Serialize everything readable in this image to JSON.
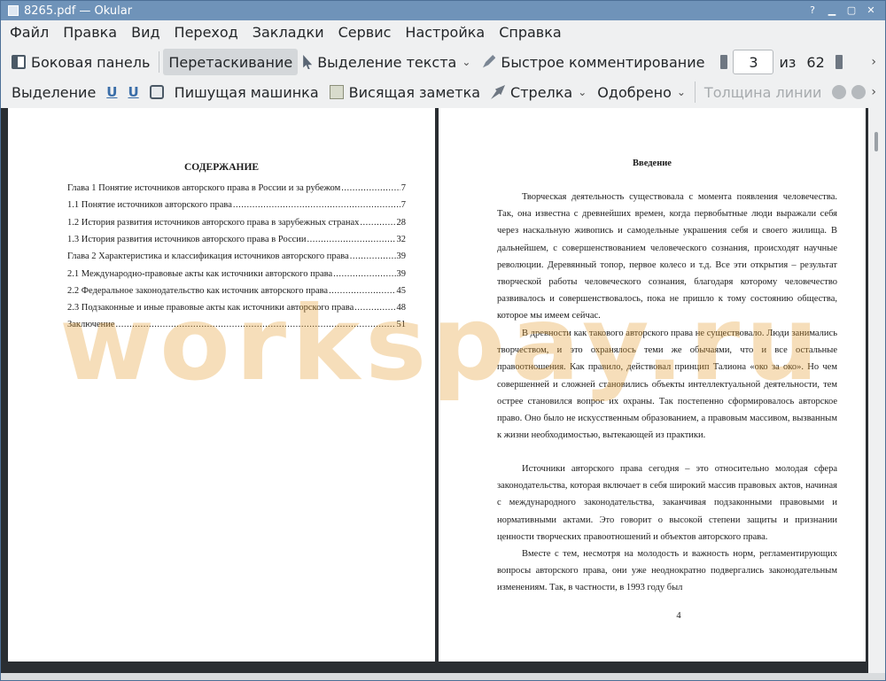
{
  "window": {
    "title": "8265.pdf  — Okular"
  },
  "menu": [
    "Файл",
    "Правка",
    "Вид",
    "Переход",
    "Закладки",
    "Сервис",
    "Настройка",
    "Справка"
  ],
  "toolbar1": {
    "sidebar": "Боковая панель",
    "drag": "Перетаскивание",
    "text_select": "Выделение текста",
    "quick_comment": "Быстрое комментирование",
    "page_current": "3",
    "page_of": "из",
    "page_total": "62"
  },
  "toolbar2": {
    "select": "Выделение",
    "typewriter": "Пишущая машинка",
    "note": "Висящая заметка",
    "arrow": "Стрелка",
    "stamp": "Одобрено",
    "line_width": "Толщина линии"
  },
  "left_page": {
    "title": "СОДЕРЖАНИЕ",
    "toc": [
      {
        "text": "Глава 1 Понятие источников авторского права в России и за рубежом",
        "page": "7"
      },
      {
        "text": "1.1 Понятие источников авторского права",
        "page": "7"
      },
      {
        "text": "1.2 История развития источников авторского права в зарубежных странах",
        "page": "28"
      },
      {
        "text": "1.3 История развития источников авторского права в России",
        "page": "32"
      },
      {
        "text": "Глава 2 Характеристика и классификация источников авторского права",
        "page": "39"
      },
      {
        "text": "2.1 Международно-правовые акты как источники авторского права",
        "page": "39"
      },
      {
        "text": "2.2 Федеральное законодательство как источник авторского права",
        "page": "45"
      },
      {
        "text": "2.3 Подзаконные и иные правовые акты как источники авторского права",
        "page": "48"
      },
      {
        "text": "Заключение",
        "page": "51"
      }
    ]
  },
  "right_page": {
    "title": "Введение",
    "paragraphs": [
      "Творческая деятельность существовала с момента появления человечества. Так, она известна с древнейших времен, когда первобытные люди выражали себя через наскальную живопись и самодельные украшения себя и своего жилища. В дальнейшем, с совершенствованием человеческого сознания, происходят научные революции. Деревянный топор, первое колесо и т.д. Все эти открытия – результат творческой работы человеческого сознания, благодаря которому человечество развивалось и совершенствовалось, пока не пришло к тому состоянию общества, которое мы имеем сейчас.",
      "В древности как такового авторского права не существовало. Люди занимались творчеством, и это охранялось теми же обычаями, что и все остальные правоотношения. Как правило, действовал принцип Талиона «око за око». Но чем совершенней и сложней становились объекты интеллектуальной деятельности, тем острее становился вопрос их охраны. Так постепенно сформировалось авторское право. Оно было не искусственным образованием, а правовым массивом, вызванным к жизни необходимостью, вытекающей из практики.",
      "Источники авторского права сегодня – это относительно молодая сфера законодательства, которая включает в себя широкий массив правовых актов, начиная с международного законодательства, заканчивая подзаконными правовыми и нормативными актами. Это говорит о высокой степени защиты и признании ценности творческих правоотношений и объектов авторского права.",
      "Вместе с тем, несмотря на молодость и важность норм, регламентирующих вопросы авторского права, они уже неоднократно подвергались законодательным изменениям. Так, в частности, в 1993 году был"
    ],
    "page_number": "4"
  },
  "watermark": "workspay.ru"
}
